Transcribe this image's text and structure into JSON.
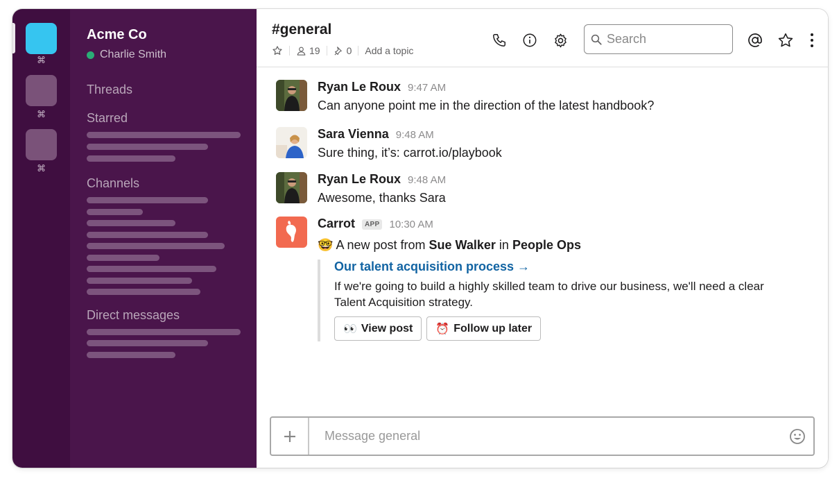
{
  "workspace_rail": {
    "items": [
      {
        "color": "#36c5f0",
        "shortcut": "⌘"
      },
      {
        "color": "#7a5279",
        "shortcut": "⌘"
      },
      {
        "color": "#7a5279",
        "shortcut": "⌘"
      }
    ]
  },
  "sidebar": {
    "team_name": "Acme Co",
    "user_name": "Charlie Smith",
    "status_color": "#2bac76",
    "sections": {
      "threads": "Threads",
      "starred": "Starred",
      "channels": "Channels",
      "direct_messages": "Direct messages"
    }
  },
  "header": {
    "channel_name": "#general",
    "member_count": "19",
    "pinned_count": "0",
    "add_topic": "Add a topic",
    "search_placeholder": "Search",
    "icons": [
      "star-icon",
      "person-icon",
      "pin-icon",
      "phone-icon",
      "info-icon",
      "gear-icon",
      "search-icon",
      "at-icon",
      "star-icon",
      "more-vertical-icon"
    ]
  },
  "messages": [
    {
      "author": "Ryan Le Roux",
      "time": "9:47 AM",
      "text": "Can anyone point me in the direction of the latest handbook?"
    },
    {
      "author": "Sara Vienna",
      "time": "9:48 AM",
      "text": "Sure thing, it’s: carrot.io/playbook"
    },
    {
      "author": "Ryan Le Roux",
      "time": "9:48 AM",
      "text": "Awesome, thanks Sara"
    },
    {
      "author": "Carrot",
      "badge": "APP",
      "time": "10:30 AM",
      "emoji": "🤓",
      "text_prefix": "A new post from",
      "post_author": "Sue Walker",
      "text_in": "in",
      "team": "People Ops",
      "attachment": {
        "title": "Our talent acquisition process →",
        "text": "If we're going to build a highly skilled team to drive our business, we'll need a clear Talent Acquisition strategy.",
        "buttons": [
          {
            "emoji": "👀",
            "label": "View post"
          },
          {
            "emoji": "⏰",
            "label": "Follow up later"
          }
        ]
      }
    }
  ],
  "composer": {
    "placeholder": "Message general"
  },
  "colors": {
    "rail_bg": "#3f0e40",
    "sidebar_bg": "#4a154b",
    "link": "#1264a3",
    "carrot_app": "#f26a50"
  }
}
